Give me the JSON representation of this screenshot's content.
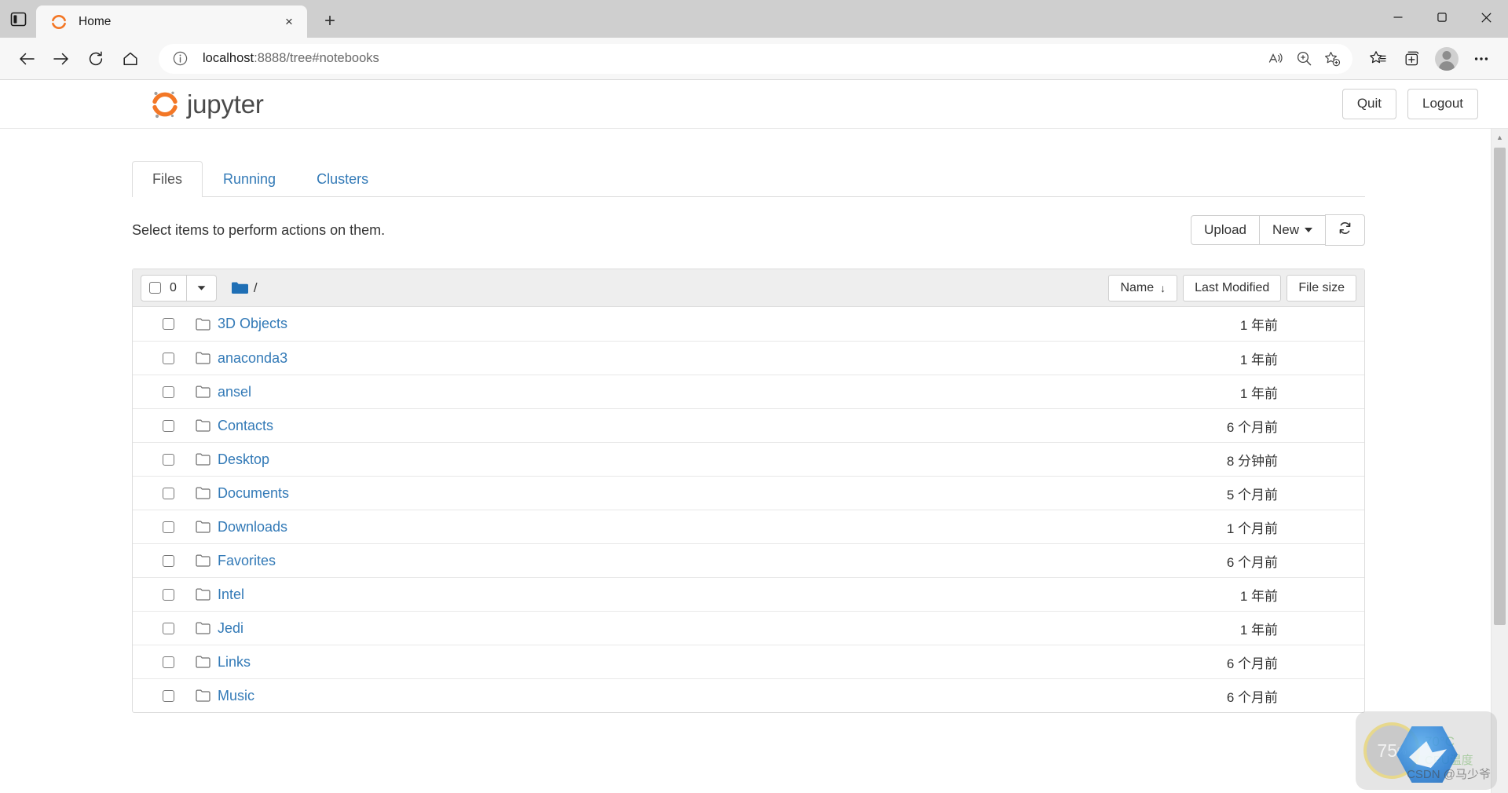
{
  "browser": {
    "tab": {
      "title": "Home",
      "favicon_name": "jupyter-favicon",
      "close_label": "×"
    },
    "new_tab_label": "+",
    "window_controls": {
      "minimize": "–",
      "maximize": "❐",
      "close": "✕"
    },
    "nav": {
      "back": "←",
      "forward": "→",
      "reload": "↻",
      "home": "⌂"
    },
    "address": {
      "scheme_host": "localhost",
      "rest": ":8888/tree#notebooks",
      "info_icon": "ⓘ"
    },
    "toolbar_icons": [
      "read-aloud-icon",
      "zoom-icon",
      "add-favorite-icon",
      "favorites-icon",
      "collections-icon",
      "profile-icon",
      "settings-more-icon"
    ],
    "more_label": "⋯"
  },
  "jupyter": {
    "logo_text": "jupyter",
    "quit_label": "Quit",
    "logout_label": "Logout",
    "tabs": [
      {
        "label": "Files",
        "active": true
      },
      {
        "label": "Running",
        "active": false
      },
      {
        "label": "Clusters",
        "active": false
      }
    ],
    "hint": "Select items to perform actions on them.",
    "upload_label": "Upload",
    "new_label": "New",
    "refresh_label": "↻",
    "toolbar": {
      "selected_count": "0",
      "breadcrumb_root": "/",
      "sort_name": "Name",
      "sort_name_arrow": "↓",
      "sort_last_modified": "Last Modified",
      "sort_file_size": "File size"
    },
    "files": [
      {
        "name": "3D Objects",
        "modified": "1 年前"
      },
      {
        "name": "anaconda3",
        "modified": "1 年前"
      },
      {
        "name": "ansel",
        "modified": "1 年前"
      },
      {
        "name": "Contacts",
        "modified": "6 个月前"
      },
      {
        "name": "Desktop",
        "modified": "8 分钟前"
      },
      {
        "name": "Documents",
        "modified": "5 个月前"
      },
      {
        "name": "Downloads",
        "modified": "1 个月前"
      },
      {
        "name": "Favorites",
        "modified": "6 个月前"
      },
      {
        "name": "Intel",
        "modified": "1 年前"
      },
      {
        "name": "Jedi",
        "modified": "1 年前"
      },
      {
        "name": "Links",
        "modified": "6 个月前"
      },
      {
        "name": "Music",
        "modified": "6 个月前"
      }
    ]
  },
  "overlay": {
    "cpu_percent": "75",
    "cpu_percent_unit": "%",
    "cpu_temp": "70°C",
    "cpu_temp_label": "CPU温度",
    "watermark": "CSDN @马少爷"
  },
  "colors": {
    "link": "#337ab7",
    "folder_blue": "#1f6fb5",
    "accent_orange": "#f37726"
  }
}
